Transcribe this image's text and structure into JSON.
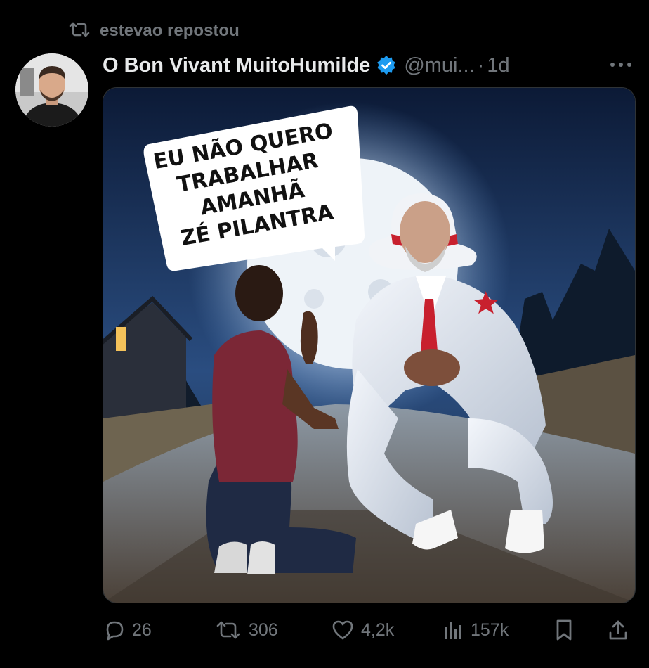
{
  "repost": {
    "icon": "repost-icon",
    "label": "estevao repostou"
  },
  "author": {
    "avatar": "avatar",
    "name": "O Bon Vivant MuitoHumilde",
    "verified_icon": "verified-badge-icon",
    "handle": "@mui...",
    "separator": "·",
    "time": "1d"
  },
  "more_icon": "more-icon",
  "media": {
    "bubble_lines": [
      "EU NÃO QUERO",
      "TRABALHAR",
      "AMANHÃ",
      "ZÉ PILANTRA"
    ]
  },
  "actions": {
    "replies": {
      "icon": "reply-icon",
      "count": "26"
    },
    "reposts": {
      "icon": "repost-icon",
      "count": "306"
    },
    "likes": {
      "icon": "heart-icon",
      "count": "4,2k"
    },
    "views": {
      "icon": "views-icon",
      "count": "157k"
    },
    "bookmark": {
      "icon": "bookmark-icon"
    },
    "share": {
      "icon": "share-icon"
    }
  },
  "colors": {
    "background": "#000000",
    "text": "#e7e9ea",
    "muted": "#71767b",
    "verified": "#1d9bf0"
  }
}
